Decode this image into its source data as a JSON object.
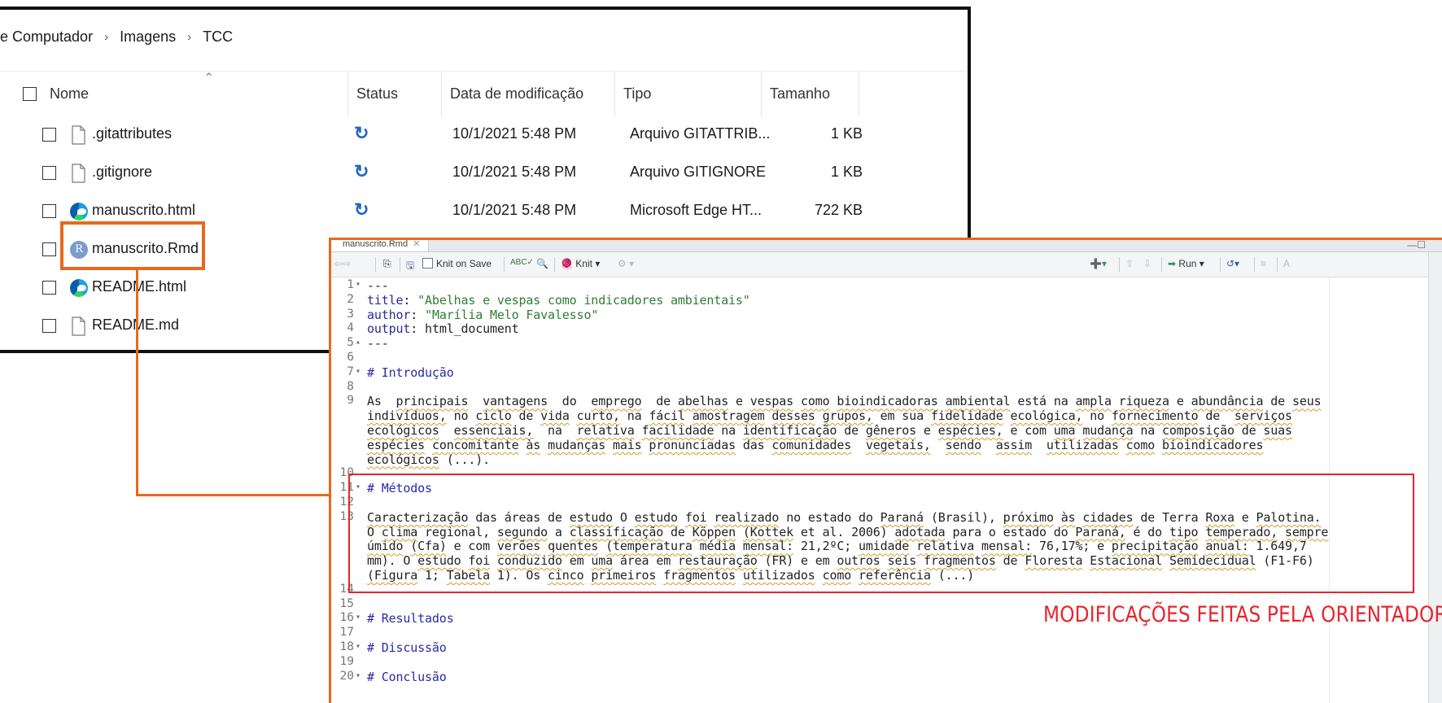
{
  "explorer": {
    "breadcrumb": [
      "e Computador",
      "Imagens",
      "TCC"
    ],
    "columns": {
      "name": "Nome",
      "status": "Status",
      "date": "Data de modificação",
      "type": "Tipo",
      "size": "Tamanho"
    },
    "files": [
      {
        "name": ".gitattributes",
        "icon": "blank-file-icon",
        "date": "10/1/2021 5:48 PM",
        "type": "Arquivo GITATTRIB...",
        "size": "1 KB",
        "status": "sync-icon"
      },
      {
        "name": ".gitignore",
        "icon": "blank-file-icon",
        "date": "10/1/2021 5:48 PM",
        "type": "Arquivo GITIGNORE",
        "size": "1 KB",
        "status": "sync-icon"
      },
      {
        "name": "manuscrito.html",
        "icon": "edge-icon",
        "date": "10/1/2021 5:48 PM",
        "type": "Microsoft Edge HT...",
        "size": "722 KB",
        "status": "sync-icon"
      },
      {
        "name": "manuscrito.Rmd",
        "icon": "r-file-icon"
      },
      {
        "name": "README.html",
        "icon": "edge-icon"
      },
      {
        "name": "README.md",
        "icon": "blank-file-icon"
      }
    ]
  },
  "editor": {
    "tab": "manuscrito.Rmd",
    "toolbar": {
      "knit_on_save": "Knit on Save",
      "knit": "Knit",
      "run": "Run"
    },
    "lines": [
      {
        "n": "1",
        "fold": "▾",
        "t": "---"
      },
      {
        "n": "2",
        "t": "title: \"Abelhas e vespas como indicadores ambientais\""
      },
      {
        "n": "3",
        "t": "author: \"Marília Melo Favalesso\""
      },
      {
        "n": "4",
        "t": "output: html_document"
      },
      {
        "n": "5",
        "fold": "▴",
        "t": "---"
      },
      {
        "n": "6",
        "t": ""
      },
      {
        "n": "7",
        "fold": "▾",
        "t": "# Introdução"
      },
      {
        "n": "8",
        "t": ""
      },
      {
        "n": "9",
        "t": "As  principais  vantagens  do  emprego  de abelhas e vespas como bioindicadoras ambiental está na ampla riqueza e abundância de seus"
      },
      {
        "n": "",
        "t": "indivíduos, no ciclo de vida curto, na fácil amostragem desses grupos, em sua fidelidade ecológica, no fornecimento de  serviços"
      },
      {
        "n": "",
        "t": "ecológicos  essenciais,  na  relativa facilidade na identificação de gêneros e espécies, e com uma mudança na composição de suas"
      },
      {
        "n": "",
        "t": "espécies concomitante às mudanças mais pronunciadas das comunidades  vegetais,  sendo  assim  utilizadas como bioindicadores"
      },
      {
        "n": "",
        "t": "ecológicos (...)."
      },
      {
        "n": "10",
        "t": ""
      },
      {
        "n": "11",
        "fold": "▾",
        "t": "# Métodos"
      },
      {
        "n": "12",
        "t": ""
      },
      {
        "n": "13",
        "t": "Caracterização das áreas de estudo O estudo foi realizado no estado do Paraná (Brasil), próximo às cidades de Terra Roxa e Palotina."
      },
      {
        "n": "",
        "t": "O clima regional, segundo a classificação de Köppen (Kottek et al. 2006) adotada para o estado do Paraná, é do tipo temperado, sempre"
      },
      {
        "n": "",
        "t": "úmido (Cfa) e com verões quentes (temperatura média mensal: 21,2ºC; umidade relativa mensal: 76,17%; e precipitação anual: 1.649,7"
      },
      {
        "n": "",
        "t": "mm). O estudo foi conduzido em uma área em restauração (FR) e em outros seis fragmentos de Floresta Estacional Semidecidual (F1-F6)"
      },
      {
        "n": "",
        "t": "(Figura 1; Tabela 1). Os cinco primeiros fragmentos utilizados como referência (...)"
      },
      {
        "n": "14",
        "t": ""
      },
      {
        "n": "15",
        "t": ""
      },
      {
        "n": "16",
        "fold": "▾",
        "t": "# Resultados"
      },
      {
        "n": "17",
        "t": ""
      },
      {
        "n": "18",
        "fold": "▾",
        "t": "# Discussão"
      },
      {
        "n": "19",
        "t": ""
      },
      {
        "n": "20",
        "fold": "▾",
        "t": "# Conclusão"
      }
    ]
  },
  "annotation": "MODIFICAÇÕES FEITAS PELA ORIENTADORA",
  "colors": {
    "highlight_orange": "#e66a1e",
    "annotation_red": "#e8242c",
    "sync_blue": "#1f66c1"
  }
}
